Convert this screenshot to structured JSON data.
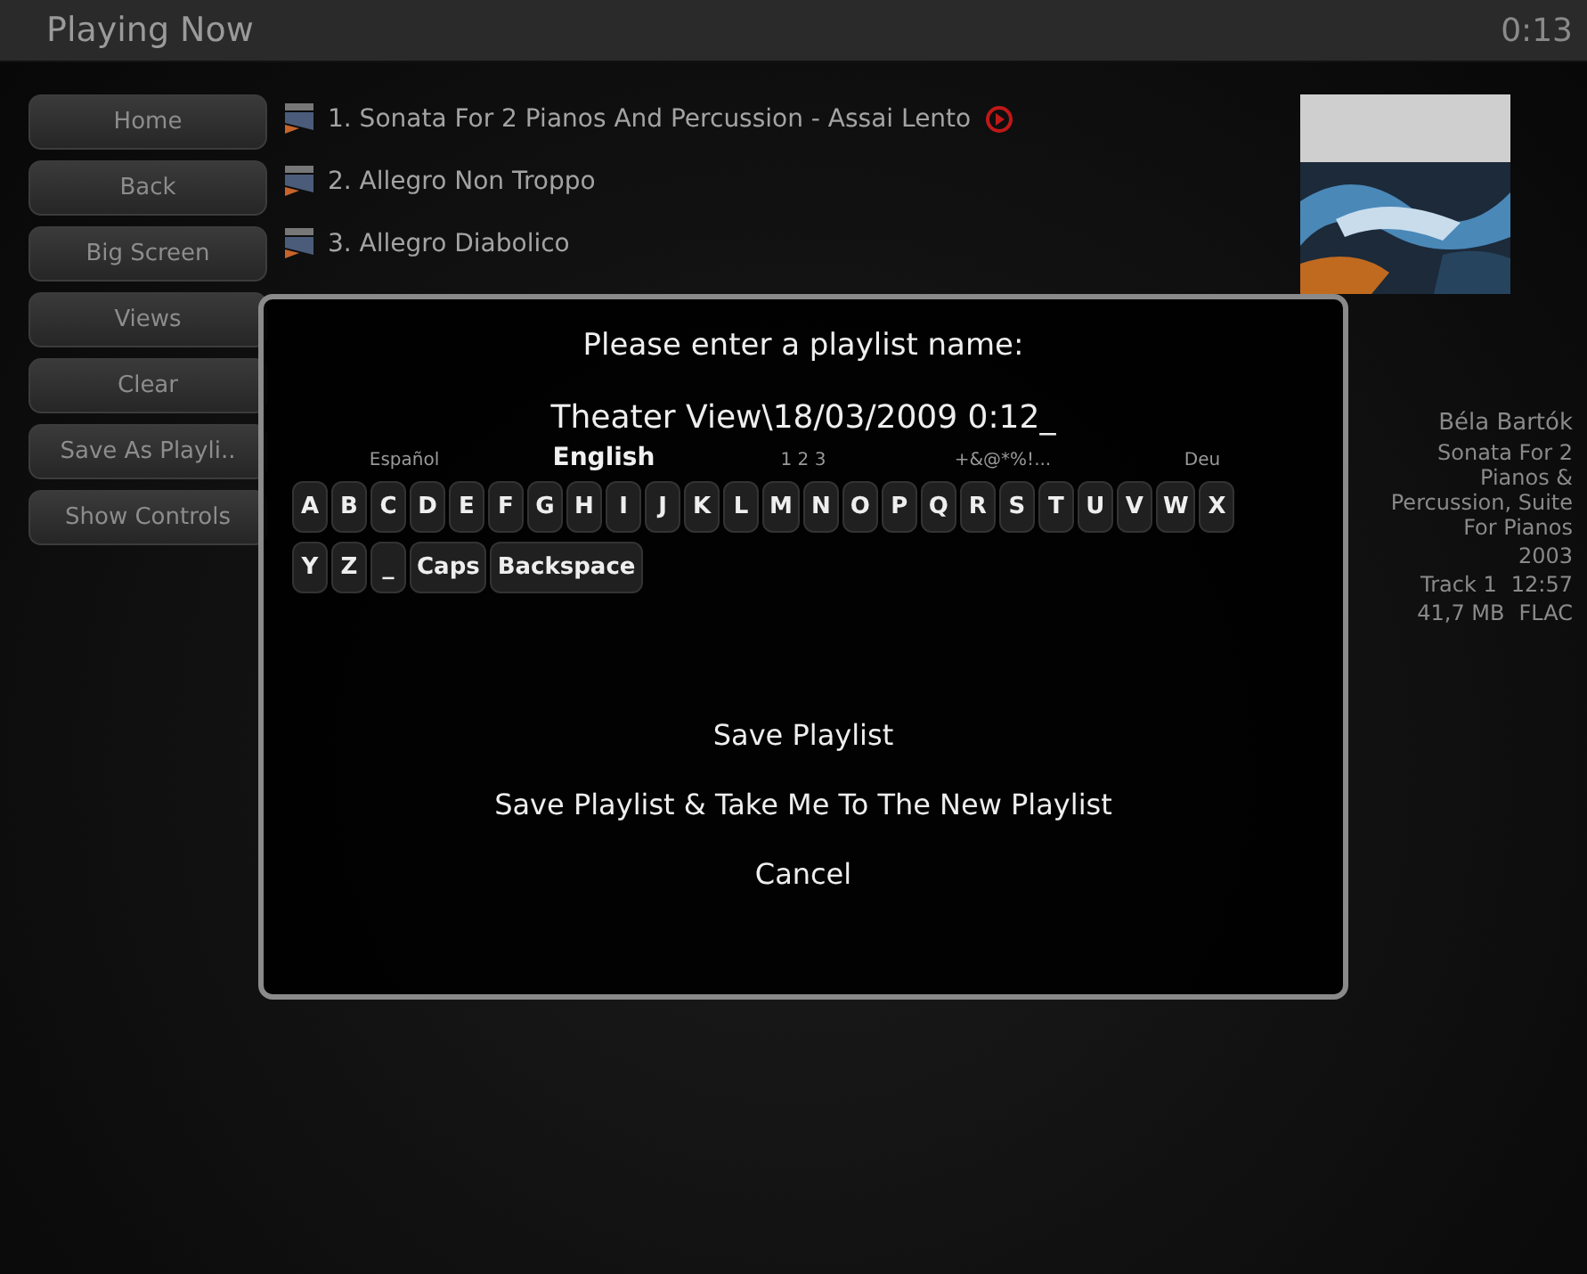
{
  "header": {
    "title": "Playing Now",
    "time": "0:13"
  },
  "sidebar": {
    "items": [
      "Home",
      "Back",
      "Big Screen",
      "Views",
      "Clear",
      "Save As Playli..",
      "Show Controls"
    ]
  },
  "tracks": [
    {
      "title": "1. Sonata For 2 Pianos And Percussion - Assai Lento",
      "playing": true
    },
    {
      "title": "2. Allegro Non Troppo",
      "playing": false
    },
    {
      "title": "3. Allegro Diabolico",
      "playing": false
    }
  ],
  "info": [
    "Béla Bartók",
    "Sonata For 2 Pianos & Percussion, Suite For Pianos",
    "2003",
    "Track 1",
    "12:57",
    "41,7 MB",
    "FLAC"
  ],
  "dialog": {
    "prompt": "Please enter a playlist name:",
    "value": "Theater View\\18/03/2009 0:12_",
    "layouts": [
      {
        "label": "Español",
        "selected": false
      },
      {
        "label": "English",
        "selected": true
      },
      {
        "label": "1 2 3",
        "selected": false
      },
      {
        "label": "+&@*%!...",
        "selected": false
      },
      {
        "label": "Deu",
        "selected": false
      }
    ],
    "keys": [
      [
        "A",
        "B",
        "C",
        "D",
        "E",
        "F",
        "G",
        "H",
        "I",
        "J",
        "K",
        "L",
        "M",
        "N",
        "O",
        "P",
        "Q",
        "R",
        "S",
        "T",
        "U",
        "V",
        "W",
        "X"
      ],
      [
        "Y",
        "Z",
        "_",
        "Caps",
        "Backspace"
      ]
    ],
    "actions": [
      "Save Playlist",
      "Save Playlist & Take Me To The New Playlist",
      "Cancel"
    ]
  }
}
